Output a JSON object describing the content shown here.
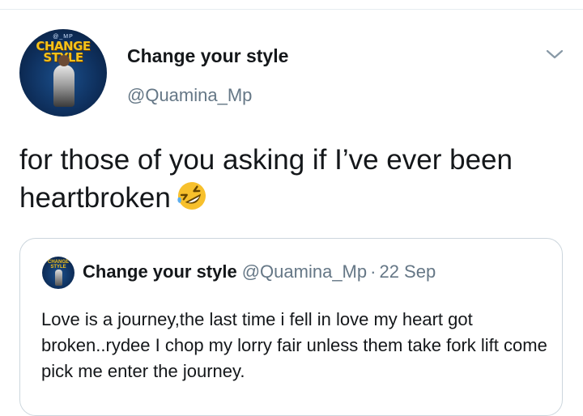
{
  "tweet": {
    "author": {
      "display_name": "Change your style",
      "handle": "@Quamina_Mp",
      "avatar_text": "CHANGE STYLE",
      "avatar_logo": "@_MP"
    },
    "text": "for those of you asking if I’ve ever been heartbroken",
    "emoji": "rolling-on-floor-laughing-emoji",
    "menu_icon": "chevron-down-icon"
  },
  "quoted_tweet": {
    "display_name": "Change your style",
    "handle": "@Quamina_Mp",
    "separator": "·",
    "date": "22 Sep",
    "text": "Love is a journey,the last time i fell in love my heart got broken..rydee I chop my lorry fair unless them take fork lift come pick me enter the journey."
  },
  "colors": {
    "text": "#14171a",
    "secondary": "#657786",
    "border": "#ccd6dd",
    "emoji": "#f7c02c"
  }
}
